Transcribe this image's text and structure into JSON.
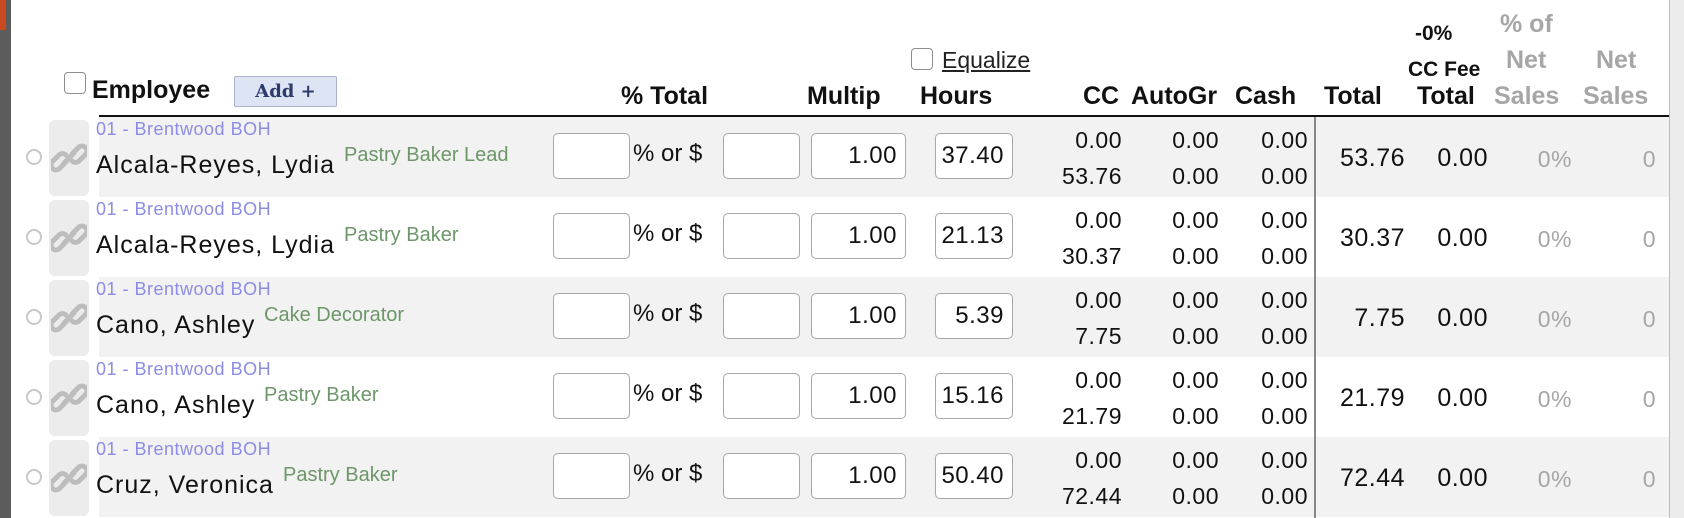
{
  "header": {
    "employee": "Employee",
    "add_button": "Add +",
    "pct_total": "% Total",
    "multip": "Multip",
    "equalize": " Equalize",
    "hours": "Hours",
    "cc": "CC",
    "autogr": "AutoGr",
    "cash": "Cash",
    "total": "Total",
    "cc_fee_pct": "-0%",
    "cc_fee_label": "CC Fee",
    "cc_fee_total": "Total",
    "pct_of": "% of",
    "pct_net": "Net",
    "pct_sales": "Sales",
    "net": "Net",
    "net_sales": "Sales"
  },
  "pct_or_label": "% or $",
  "rows": [
    {
      "location": "01 - Brentwood BOH",
      "name": "Alcala-Reyes, Lydia",
      "role": "Pastry Baker Lead",
      "pct": "",
      "amount": "",
      "multip": "1.00",
      "hours": "37.40",
      "cc1": "0.00",
      "cc2": "53.76",
      "autogr1": "0.00",
      "autogr2": "0.00",
      "cash1": "0.00",
      "cash2": "0.00",
      "total": "53.76",
      "cc_fee": "0.00",
      "pct_net_sales": "0%",
      "net_sales": "0"
    },
    {
      "location": "01 - Brentwood BOH",
      "name": "Alcala-Reyes, Lydia",
      "role": "Pastry Baker",
      "pct": "",
      "amount": "",
      "multip": "1.00",
      "hours": "21.13",
      "cc1": "0.00",
      "cc2": "30.37",
      "autogr1": "0.00",
      "autogr2": "0.00",
      "cash1": "0.00",
      "cash2": "0.00",
      "total": "30.37",
      "cc_fee": "0.00",
      "pct_net_sales": "0%",
      "net_sales": "0"
    },
    {
      "location": "01 - Brentwood BOH",
      "name": "Cano, Ashley",
      "role": "Cake Decorator",
      "pct": "",
      "amount": "",
      "multip": "1.00",
      "hours": "5.39",
      "cc1": "0.00",
      "cc2": "7.75",
      "autogr1": "0.00",
      "autogr2": "0.00",
      "cash1": "0.00",
      "cash2": "0.00",
      "total": "7.75",
      "cc_fee": "0.00",
      "pct_net_sales": "0%",
      "net_sales": "0"
    },
    {
      "location": "01 - Brentwood BOH",
      "name": "Cano, Ashley",
      "role": "Pastry Baker",
      "pct": "",
      "amount": "",
      "multip": "1.00",
      "hours": "15.16",
      "cc1": "0.00",
      "cc2": "21.79",
      "autogr1": "0.00",
      "autogr2": "0.00",
      "cash1": "0.00",
      "cash2": "0.00",
      "total": "21.79",
      "cc_fee": "0.00",
      "pct_net_sales": "0%",
      "net_sales": "0"
    },
    {
      "location": "01 - Brentwood BOH",
      "name": "Cruz, Veronica",
      "role": "Pastry Baker",
      "pct": "",
      "amount": "",
      "multip": "1.00",
      "hours": "50.40",
      "cc1": "0.00",
      "cc2": "72.44",
      "autogr1": "0.00",
      "autogr2": "0.00",
      "cash1": "0.00",
      "cash2": "0.00",
      "total": "72.44",
      "cc_fee": "0.00",
      "pct_net_sales": "0%",
      "net_sales": "0"
    }
  ]
}
